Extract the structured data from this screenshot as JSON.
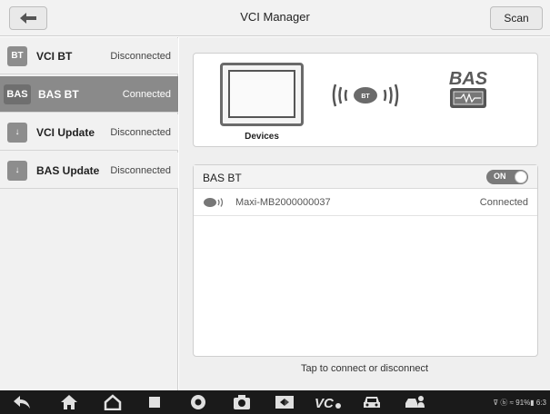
{
  "header": {
    "title": "VCI Manager",
    "scan_label": "Scan",
    "back_icon": "arrow-left-icon"
  },
  "sidebar": {
    "items": [
      {
        "badge": "BT",
        "label": "VCI BT",
        "status": "Disconnected",
        "icon": "bt-badge",
        "active": false
      },
      {
        "badge": "BAS",
        "label": "BAS BT",
        "status": "Connected",
        "icon": "bas-badge",
        "active": true
      },
      {
        "badge": "↓",
        "label": "VCI Update",
        "status": "Disconnected",
        "icon": "download-icon",
        "active": false
      },
      {
        "badge": "↓",
        "label": "BAS Update",
        "status": "Disconnected",
        "icon": "download-icon",
        "active": false
      }
    ]
  },
  "diagram": {
    "devices_label": "Devices",
    "bt_badge": "BT",
    "bas_logo": "BAS"
  },
  "bt_panel": {
    "title": "BAS BT",
    "toggle_label": "ON",
    "devices": [
      {
        "name": "Maxi-MB2000000037",
        "status": "Connected"
      }
    ]
  },
  "hint": "Tap to connect or disconnect",
  "system_bar": {
    "status": "⊽ ⓑ ≈ 91%▮ 6:3"
  },
  "colors": {
    "active_item": "#8a8a8a",
    "panel_bg": "#efefef",
    "nav_bg": "#1a1a1a"
  }
}
